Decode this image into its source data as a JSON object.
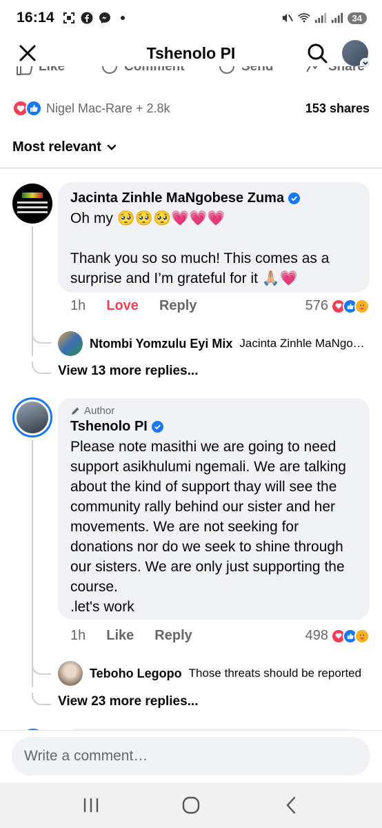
{
  "status_bar": {
    "time": "16:14",
    "battery": "34",
    "left_icons": [
      "screenshot-icon",
      "facebook-icon",
      "messenger-icon",
      "dot-icon"
    ],
    "right_icons": [
      "mute-icon",
      "wifi-icon",
      "signal-icon",
      "signal-icon"
    ]
  },
  "header": {
    "title": "Tshenolo PI"
  },
  "actions": {
    "like": "Like",
    "comment": "Comment",
    "send": "Send",
    "share": "Share"
  },
  "reactions_summary": {
    "text": "Nigel Mac-Rare + 2.8k",
    "shares": "153 shares"
  },
  "sort": {
    "label": "Most relevant"
  },
  "comments": [
    {
      "author": "Jacinta Zinhle MaNgobese Zuma",
      "verified": true,
      "text": "Oh my 🥺🥺🥺💗💗💗\n\nThank you so so much! This comes as a surprise and I’m grateful for it 🙏🏼💗",
      "time": "1h",
      "reaction_label": "Love",
      "reply_label": "Reply",
      "reaction_count": "576",
      "reply_preview": {
        "author": "Ntombi Yomzulu Eyi Mix",
        "text": "Jacinta Zinhle MaNgobese Zuma"
      },
      "view_more": "View 13 more replies..."
    },
    {
      "author_tag": "Author",
      "author": "Tshenolo PI",
      "verified": true,
      "text": "Please note masithi we are going to need support asikhulumi ngemali. We are talking about the kind of support thay will see the community rally behind our sister and her movements. We are not seeking for donations nor do we seek to shine through our sisters. We are only just supporting the course.\n.let's work",
      "time": "1h",
      "reaction_label": "Like",
      "reply_label": "Reply",
      "reaction_count": "498",
      "reply_preview": {
        "author": "Teboho Legopo",
        "text": "Those threats should be reported"
      },
      "view_more": "View 23 more replies..."
    }
  ],
  "compose": {
    "placeholder": "Write a comment…"
  },
  "colors": {
    "accent": "#1877f2",
    "love": "#f33e58",
    "secondary_text": "#65676b",
    "bubble": "#f0f2f5"
  }
}
